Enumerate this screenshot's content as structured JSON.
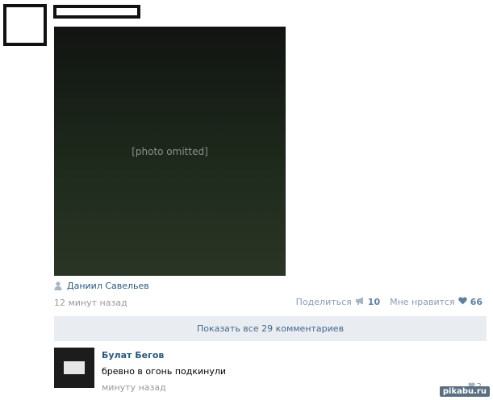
{
  "post": {
    "image_alt": "[photo omitted]",
    "author_name": "Даниил Савельев",
    "time": "12 минут назад",
    "share_label": "Поделиться",
    "share_count": "10",
    "like_label": "Мне нравится",
    "like_count": "66"
  },
  "comments": {
    "show_all_label": "Показать все 29 комментариев",
    "items": [
      {
        "author": "Булат Бегов",
        "text": "бревно в огонь подкинули",
        "time": "минуту назад",
        "like_count": "2"
      }
    ]
  },
  "watermark": {
    "text": "pikabu.ru"
  },
  "colors": {
    "link": "#2b587a",
    "muted": "#999999",
    "accent": "#5e7fa1",
    "comments_bar": "#e9edf1"
  }
}
